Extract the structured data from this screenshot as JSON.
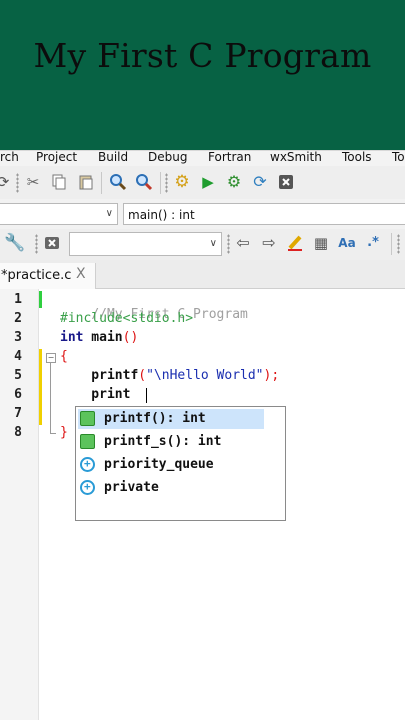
{
  "banner": {
    "title": "My First C Program",
    "color": "#076244"
  },
  "menubar": {
    "items": [
      "rch",
      "Project",
      "Build",
      "Debug",
      "Fortran",
      "wxSmith",
      "Tools",
      "To"
    ]
  },
  "toolbar2": {
    "function_combo": {
      "value": "main() : int"
    }
  },
  "editor": {
    "tab": {
      "label": "*practice.c",
      "close": "X"
    },
    "line_numbers": [
      "1",
      "2",
      "3",
      "4",
      "5",
      "6",
      "7",
      "8"
    ],
    "lines": {
      "l1": "//My First C Program",
      "l2a": "#",
      "l2b": "include<stdio.h>",
      "l3a": "int",
      "l3b": " main",
      "l3c": "()",
      "l4": "{",
      "l5a": "    printf",
      "l5b": "(",
      "l5c": "\"\\nHello World\"",
      "l5d": ");",
      "l6": "    print",
      "l7": "",
      "l8": "}"
    }
  },
  "autocomplete": {
    "items": [
      {
        "icon": "function-icon",
        "label": "printf(): int",
        "selected": true
      },
      {
        "icon": "function-icon",
        "label": "printf_s(): int",
        "selected": false
      },
      {
        "icon": "class-icon",
        "label": "priority_queue",
        "selected": false
      },
      {
        "icon": "class-icon",
        "label": "private",
        "selected": false
      }
    ]
  }
}
